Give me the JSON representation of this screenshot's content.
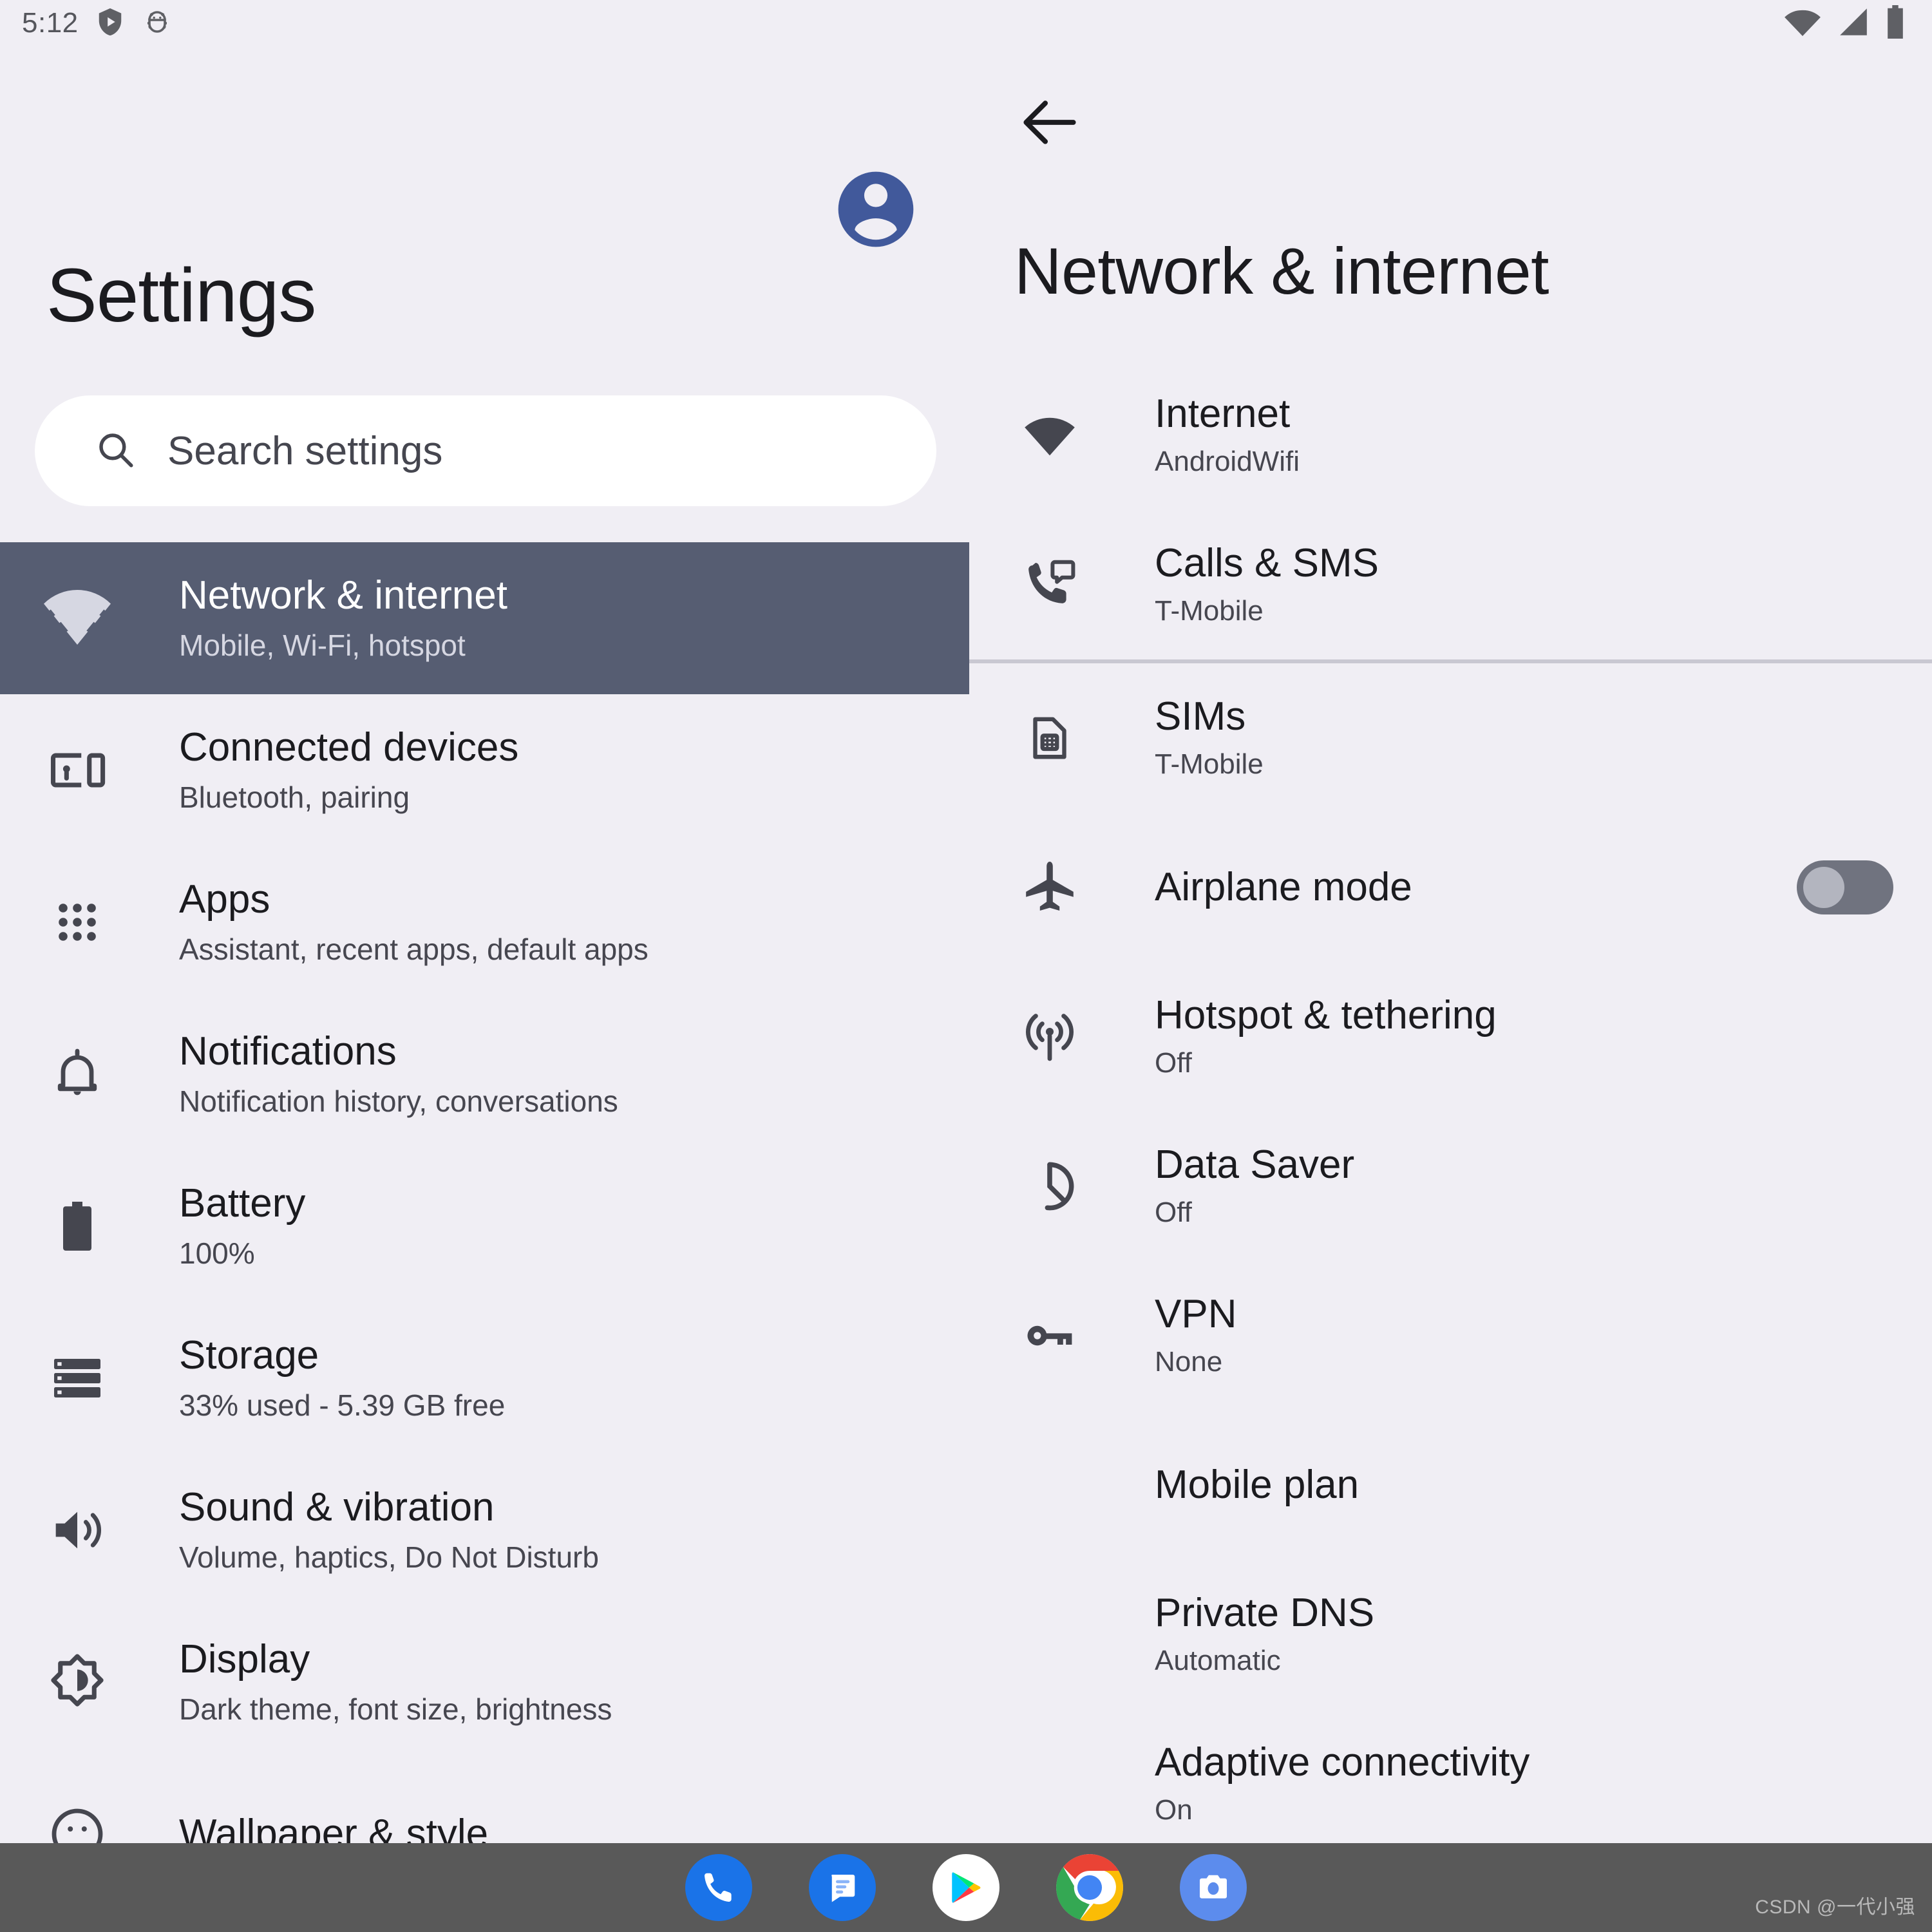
{
  "status_bar": {
    "time": "5:12",
    "left_icons": [
      "play-protect-shield-icon",
      "android-debug-bug-icon"
    ],
    "right_icons": [
      "wifi-icon",
      "cellular-signal-icon",
      "battery-icon"
    ]
  },
  "left_pane": {
    "title": "Settings",
    "avatar": "account-circle-icon",
    "avatar_color": "#41599b",
    "search": {
      "placeholder": "Search settings",
      "icon": "search-icon"
    },
    "selected_index": 0,
    "selected_bg": "#565d72",
    "items": [
      {
        "icon": "wifi-icon",
        "label": "Network & internet",
        "summary": "Mobile, Wi-Fi, hotspot"
      },
      {
        "icon": "connected-devices-icon",
        "label": "Connected devices",
        "summary": "Bluetooth, pairing"
      },
      {
        "icon": "apps-grid-icon",
        "label": "Apps",
        "summary": "Assistant, recent apps, default apps"
      },
      {
        "icon": "bell-icon",
        "label": "Notifications",
        "summary": "Notification history, conversations"
      },
      {
        "icon": "battery-icon",
        "label": "Battery",
        "summary": "100%"
      },
      {
        "icon": "storage-icon",
        "label": "Storage",
        "summary": "33% used - 5.39 GB free"
      },
      {
        "icon": "volume-up-icon",
        "label": "Sound & vibration",
        "summary": "Volume, haptics, Do Not Disturb"
      },
      {
        "icon": "brightness-icon",
        "label": "Display",
        "summary": "Dark theme, font size, brightness"
      },
      {
        "icon": "wallpaper-style-icon",
        "label": "Wallpaper & style",
        "summary": ""
      }
    ]
  },
  "right_pane": {
    "back_icon": "back-arrow-icon",
    "title": "Network & internet",
    "items": [
      {
        "icon": "wifi-icon",
        "label": "Internet",
        "summary": "AndroidWifi",
        "control": "none",
        "divider_after": false
      },
      {
        "icon": "calls-sms-icon",
        "label": "Calls & SMS",
        "summary": "T-Mobile",
        "control": "none",
        "divider_after": true
      },
      {
        "icon": "sim-card-icon",
        "label": "SIMs",
        "summary": "T-Mobile",
        "control": "none",
        "divider_after": false
      },
      {
        "icon": "airplane-icon",
        "label": "Airplane mode",
        "summary": "",
        "control": "toggle",
        "toggle_on": false,
        "divider_after": false
      },
      {
        "icon": "hotspot-icon",
        "label": "Hotspot & tethering",
        "summary": "Off",
        "control": "none",
        "divider_after": false
      },
      {
        "icon": "data-saver-icon",
        "label": "Data Saver",
        "summary": "Off",
        "control": "none",
        "divider_after": false
      },
      {
        "icon": "vpn-key-icon",
        "label": "VPN",
        "summary": "None",
        "control": "none",
        "divider_after": false
      },
      {
        "icon": "",
        "label": "Mobile plan",
        "summary": "",
        "control": "none",
        "divider_after": false
      },
      {
        "icon": "",
        "label": "Private DNS",
        "summary": "Automatic",
        "control": "none",
        "divider_after": false
      },
      {
        "icon": "",
        "label": "Adaptive connectivity",
        "summary": "On",
        "control": "none",
        "divider_after": false
      }
    ]
  },
  "dock": {
    "apps": [
      {
        "name": "phone-app-icon",
        "label": "Phone"
      },
      {
        "name": "messages-app-icon",
        "label": "Messages"
      },
      {
        "name": "play-store-app-icon",
        "label": "Play Store"
      },
      {
        "name": "chrome-app-icon",
        "label": "Chrome"
      },
      {
        "name": "camera-app-icon",
        "label": "Camera"
      }
    ],
    "background": "#595959"
  },
  "watermark": "CSDN @一代小强"
}
